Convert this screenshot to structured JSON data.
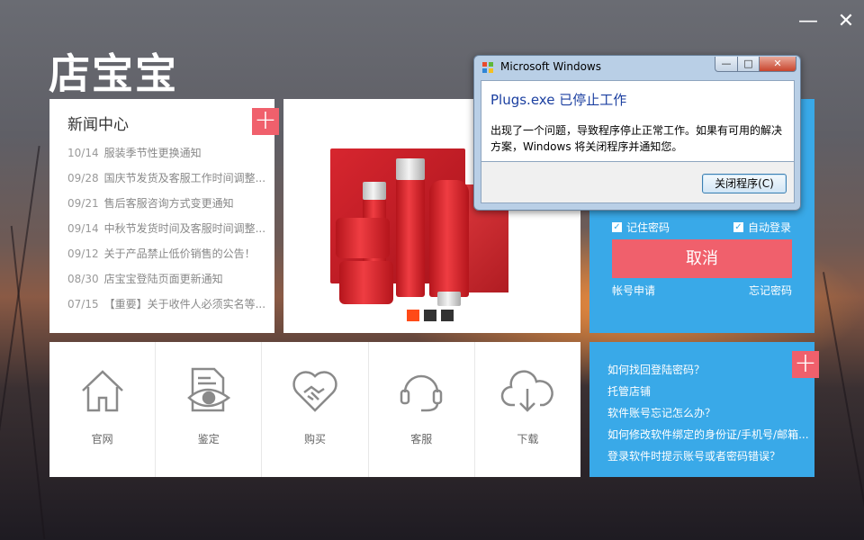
{
  "app": {
    "logo": "店宝宝",
    "minimize_label": "—",
    "close_label": "✕"
  },
  "news": {
    "title": "新闻中心",
    "items": [
      {
        "date": "10/14",
        "text": "服装季节性更换通知"
      },
      {
        "date": "09/28",
        "text": "国庆节发货及客服工作时间调整..."
      },
      {
        "date": "09/21",
        "text": "售后客服咨询方式变更通知"
      },
      {
        "date": "09/14",
        "text": "中秋节发货时间及客服时间调整..."
      },
      {
        "date": "09/12",
        "text": "关于产品禁止低价销售的公告！"
      },
      {
        "date": "08/30",
        "text": "店宝宝登陆页面更新通知"
      },
      {
        "date": "07/15",
        "text": "【重要】关于收件人必须实名等..."
      }
    ]
  },
  "banner": {
    "active_index": 0,
    "slide_count": 3
  },
  "login": {
    "remember_password": "记住密码",
    "auto_login": "自动登录",
    "cancel": "取消",
    "register": "帐号申请",
    "forgot_password": "忘记密码"
  },
  "tiles": [
    {
      "label": "官网",
      "icon": "home-icon"
    },
    {
      "label": "鉴定",
      "icon": "eye-document-icon"
    },
    {
      "label": "购买",
      "icon": "handshake-heart-icon"
    },
    {
      "label": "客服",
      "icon": "headset-icon"
    },
    {
      "label": "下载",
      "icon": "cloud-download-icon"
    }
  ],
  "faq": {
    "items": [
      "如何找回登陆密码？",
      "托管店铺",
      "软件账号忘记怎么办？",
      "如何修改软件绑定的身份证/手机号/邮箱...",
      "登录软件时提示账号或者密码错误？"
    ]
  },
  "dialog": {
    "title": "Microsoft Windows",
    "heading": "Plugs.exe 已停止工作",
    "message": "出现了一个问题，导致程序停止正常工作。如果有可用的解决方案，Windows 将关闭程序并通知您。",
    "button": "关闭程序(C)",
    "minimize": "—",
    "maximize": "□",
    "close": "✕"
  },
  "colors": {
    "accent_blue": "#39a9e8",
    "accent_pink": "#f0606c",
    "active_dot": "#ff4a17"
  }
}
